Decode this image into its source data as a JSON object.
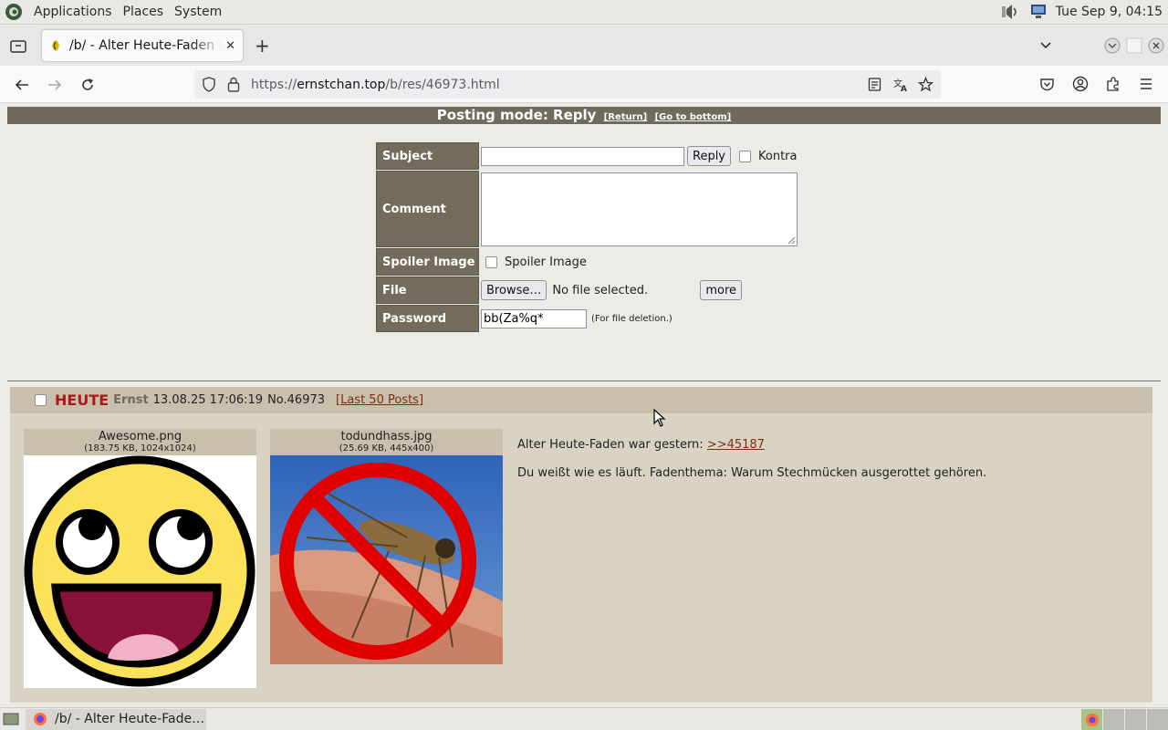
{
  "panel": {
    "menus": [
      "Applications",
      "Places",
      "System"
    ],
    "clock": "Tue Sep 9, 04:15"
  },
  "browser": {
    "tab_title": "/b/ - Alter Heute-Faden war gestern",
    "url_prefix": "https://",
    "url_domain": "ernstchan.top",
    "url_path": "/b/res/46973.html"
  },
  "mode_bar": {
    "title": "Posting mode: Reply",
    "return_link": "[Return]",
    "bottom_link": "[Go to bottom]"
  },
  "form": {
    "subject_label": "Subject",
    "subject_value": "",
    "reply_button": "Reply",
    "kontra_label": "Kontra",
    "comment_label": "Comment",
    "comment_value": "",
    "spoiler_label": "Spoiler Image",
    "spoiler_checkbox_label": "Spoiler Image",
    "file_label": "File",
    "browse_button": "Browse…",
    "file_status": "No file selected.",
    "more_button": "more",
    "password_label": "Password",
    "password_value": "bb(Za%q*",
    "password_hint": "(For file deletion.)"
  },
  "thread": {
    "subject": "HEUTE",
    "poster": "Ernst",
    "date": "13.08.25 17:06:19",
    "number": "No.46973",
    "last_posts": "[Last 50 Posts]",
    "files": [
      {
        "name": "Awesome.png",
        "meta": "(183.75 KB, 1024x1024)"
      },
      {
        "name": "todundhass.jpg",
        "meta": "(25.69 KB, 445x400)"
      }
    ],
    "message_prefix": "Alter Heute-Faden war gestern: ",
    "message_link": ">>45187",
    "message_body": "Du weißt wie es läuft. Fadenthema: Warum Stechmücken ausgerottet gehören."
  },
  "taskbar": {
    "window_title": "/b/ - Alter Heute-Fade…"
  },
  "colors": {
    "label_bg": "#736b5b",
    "thread_bg": "#d9d3c4",
    "subject_red": "#b0171a",
    "link_brown": "#7b2d12"
  }
}
